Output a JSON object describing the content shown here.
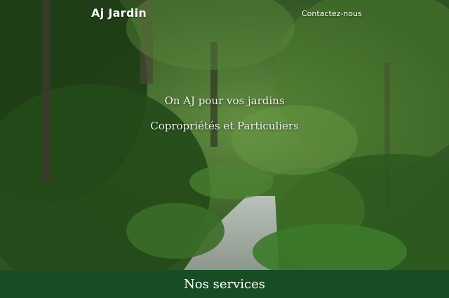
{
  "header": {
    "brand": "Aj Jardin",
    "contact_link": "Contactez-nous"
  },
  "hero": {
    "tagline_line1": "On AJ pour vos jardins",
    "tagline_line2": "Copropriétés et Particuliers",
    "background": "forest-path-photo"
  },
  "services_bar": {
    "label": "Nos services",
    "color": "#174d24"
  }
}
